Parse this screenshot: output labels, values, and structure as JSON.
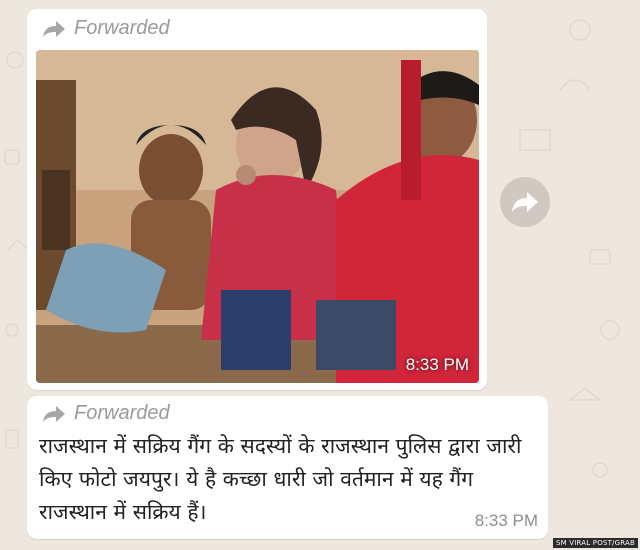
{
  "messages": [
    {
      "forwarded_label": "Forwarded",
      "time": "8:33 PM",
      "photo_alt": "photo-message"
    },
    {
      "forwarded_label": "Forwarded",
      "text": "राजस्थान में सक्रिय गैंग के सदस्यों के राजस्थान पुलिस द्वारा जारी किए फोटो जयपुर। ये है कच्छा धारी जो वर्तमान में यह गैंग राजस्थान में सक्रिय हैं।",
      "time": "8:33 PM"
    }
  ],
  "share_button": {
    "icon": "forward-arrow-icon"
  },
  "credit": "SM VIRAL POST/GRAB",
  "colors": {
    "background": "#ede7de",
    "bubble": "#ffffff",
    "forwarded_text": "#9a9a9a",
    "time_text": "#8e8e8e"
  }
}
